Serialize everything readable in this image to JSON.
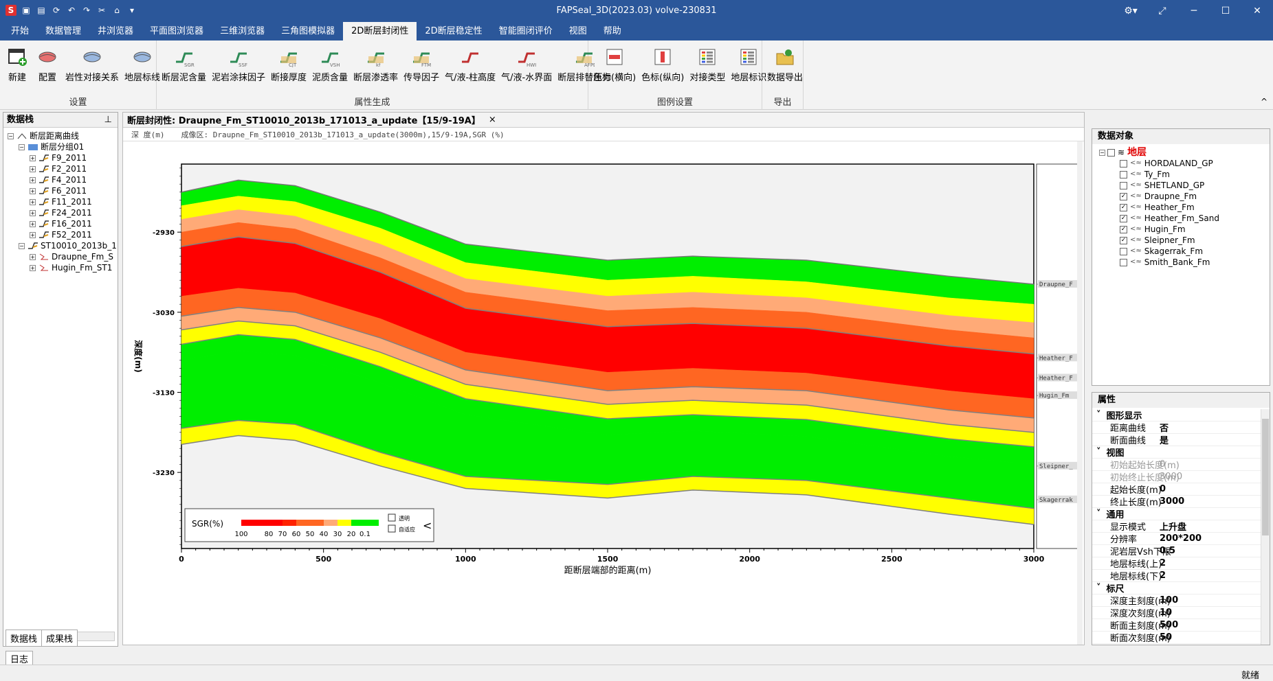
{
  "window": {
    "title": "FAPSeal_3D(2023.03) volve-230831"
  },
  "menu": [
    "开始",
    "数据管理",
    "井浏览器",
    "平面图浏览器",
    "三维浏览器",
    "三角图模拟器",
    "2D断层封闭性",
    "2D断层稳定性",
    "智能圈闭评价",
    "视图",
    "帮助"
  ],
  "menu_active": 6,
  "ribbon": {
    "groups": [
      {
        "label": "设置",
        "buttons": [
          "新建",
          "配置",
          "岩性对接关系",
          "地层标线"
        ]
      },
      {
        "label": "属性生成",
        "buttons": [
          "断层泥含量",
          "泥岩涂抹因子",
          "断接厚度",
          "泥质含量",
          "断层渗透率",
          "传导因子",
          "气/液-柱高度",
          "气/液-水界面",
          "断层排替压力"
        ]
      },
      {
        "label": "图例设置",
        "buttons": [
          "色标(横向)",
          "色标(纵向)",
          "对接类型",
          "地层标识"
        ]
      },
      {
        "label": "导出",
        "buttons": [
          "数据导出"
        ]
      }
    ],
    "icon_tags": {
      "sgr": "SGR",
      "ssf": "SSF",
      "cjt": "CJT",
      "vsh": "VSH",
      "kf": "kf",
      "ftm": "FTM",
      "hwi": "HWI",
      "afpd": "AFPD"
    }
  },
  "left_panel": {
    "title": "数据栈",
    "pin": "中",
    "tree": [
      {
        "label": "断层距离曲线",
        "level": 0
      },
      {
        "label": "断层分组01",
        "level": 1
      },
      {
        "label": "F9_2011",
        "level": 2
      },
      {
        "label": "F2_2011",
        "level": 2
      },
      {
        "label": "F4_2011",
        "level": 2
      },
      {
        "label": "F6_2011",
        "level": 2
      },
      {
        "label": "F11_2011",
        "level": 2
      },
      {
        "label": "F24_2011",
        "level": 2
      },
      {
        "label": "F16_2011",
        "level": 2
      },
      {
        "label": "F52_2011",
        "level": 2
      },
      {
        "label": "ST10010_2013b_1",
        "level": 1
      },
      {
        "label": "Draupne_Fm_S",
        "level": 2
      },
      {
        "label": "Hugin_Fm_ST1",
        "level": 2
      }
    ],
    "tabs": [
      "数据栈",
      "成果栈"
    ]
  },
  "doc": {
    "tab_title": "断层封闭性: Draupne_Fm_ST10010_2013b_171013_a_update【15/9-19A】",
    "close": "×",
    "info_depth": "深 度(m)",
    "info_zone": "成像区: Draupne_Fm_ST10010_2013b_171013_a_update(3000m),15/9-19A,SGR (%)"
  },
  "chart_data": {
    "type": "area",
    "xlabel": "距断层端部的距离(m)",
    "ylabel": "深度(m)",
    "xlim": [
      0,
      3000
    ],
    "ylim": [
      -2845,
      -3325
    ],
    "x_ticks": [
      0,
      500,
      1000,
      1500,
      2000,
      2500,
      3000
    ],
    "y_ticks": [
      -2930,
      -3030,
      -3130,
      -3230
    ],
    "x": [
      0,
      200,
      400,
      700,
      1000,
      1500,
      1800,
      2200,
      2700,
      3000
    ],
    "boundaries": [
      [
        -2880,
        -2865,
        -2872,
        -2905,
        -2945,
        -2965,
        -2960,
        -2965,
        -2985,
        -2995
      ],
      [
        -2897,
        -2885,
        -2892,
        -2925,
        -2968,
        -2990,
        -2985,
        -2992,
        -3012,
        -3020
      ],
      [
        -2914,
        -2902,
        -2910,
        -2945,
        -2988,
        -3010,
        -3005,
        -3012,
        -3034,
        -3043
      ],
      [
        -2930,
        -2918,
        -2926,
        -2962,
        -3005,
        -3028,
        -3024,
        -3030,
        -3052,
        -3062
      ],
      [
        -2948,
        -2936,
        -2944,
        -2980,
        -3025,
        -3048,
        -3044,
        -3050,
        -3072,
        -3082
      ],
      [
        -3010,
        -3000,
        -3006,
        -3038,
        -3080,
        -3105,
        -3100,
        -3106,
        -3128,
        -3138
      ],
      [
        -3035,
        -3024,
        -3030,
        -3062,
        -3102,
        -3128,
        -3123,
        -3128,
        -3152,
        -3162
      ],
      [
        -3052,
        -3041,
        -3047,
        -3080,
        -3120,
        -3145,
        -3140,
        -3146,
        -3170,
        -3180
      ],
      [
        -3070,
        -3058,
        -3064,
        -3098,
        -3138,
        -3163,
        -3158,
        -3164,
        -3188,
        -3198
      ],
      [
        -3090,
        -3078,
        -3084,
        -3118,
        -3158,
        -3183,
        -3178,
        -3185,
        -3210,
        -3220
      ],
      [
        -3175,
        -3165,
        -3170,
        -3205,
        -3235,
        -3245,
        -3235,
        -3240,
        -3262,
        -3275
      ],
      [
        -3195,
        -3184,
        -3190,
        -3222,
        -3250,
        -3262,
        -3252,
        -3258,
        -3282,
        -3295
      ]
    ],
    "band_colors": [
      "#00ee00",
      "#ffff00",
      "#ffaa77",
      "#ff6622",
      "#ff0000",
      "#ff6622",
      "#ffaa77",
      "#ffff00",
      "#00ee00",
      "#00ee00",
      "#ffff00"
    ],
    "horizon_lines": [
      {
        "name": "Draupne_Fm",
        "values": [
          -2948,
          -2936,
          -2944,
          -2980,
          -3025,
          -3048,
          -3044,
          -3050,
          -3072,
          -3082
        ]
      },
      {
        "name": "Heather_Fm",
        "values": [
          -3035,
          -3024,
          -3030,
          -3062,
          -3102,
          -3128,
          -3123,
          -3128,
          -3152,
          -3162
        ]
      },
      {
        "name": "Heather_Fm_Sand",
        "values": [
          -3052,
          -3041,
          -3047,
          -3080,
          -3120,
          -3145,
          -3140,
          -3146,
          -3170,
          -3180
        ]
      },
      {
        "name": "Hugin_Fm",
        "values": [
          -3070,
          -3058,
          -3064,
          -3098,
          -3138,
          -3163,
          -3158,
          -3164,
          -3188,
          -3198
        ]
      },
      {
        "name": "Sleipner_Fm",
        "values": [
          -3175,
          -3165,
          -3170,
          -3205,
          -3235,
          -3245,
          -3235,
          -3240,
          -3262,
          -3275
        ]
      },
      {
        "name": "Skagerrak_Fm",
        "values": [
          -3195,
          -3184,
          -3190,
          -3222,
          -3250,
          -3262,
          -3252,
          -3258,
          -3282,
          -3295
        ]
      }
    ],
    "side_labels": [
      {
        "text": "Draupne_F",
        "depth": -2995
      },
      {
        "text": "Heather_F",
        "depth": -3087
      },
      {
        "text": "Heather_F",
        "depth": -3112
      },
      {
        "text": "Hugin_Fm",
        "depth": -3134
      },
      {
        "text": "Sleipner_",
        "depth": -3222
      },
      {
        "text": "Skagerrak",
        "depth": -3264
      }
    ],
    "legend": {
      "title": "SGR(%)",
      "ticks": [
        "100",
        "80",
        "70",
        "60",
        "50",
        "40",
        "30",
        "20",
        "0.1"
      ],
      "colors": [
        "#ff0000",
        "#ff0000",
        "#ff0000",
        "#ff2200",
        "#ff6622",
        "#ff6622",
        "#ffaa77",
        "#ffff00",
        "#00ee00",
        "#00ee00"
      ],
      "options": [
        "透明",
        "自适应"
      ],
      "toggle": "<"
    }
  },
  "data_objects": {
    "title": "数据对象",
    "root": "地层",
    "items": [
      {
        "label": "HORDALAND_GP",
        "checked": false
      },
      {
        "label": "Ty_Fm",
        "checked": false
      },
      {
        "label": "SHETLAND_GP",
        "checked": false
      },
      {
        "label": "Draupne_Fm",
        "checked": true
      },
      {
        "label": "Heather_Fm",
        "checked": true
      },
      {
        "label": "Heather_Fm_Sand",
        "checked": true
      },
      {
        "label": "Hugin_Fm",
        "checked": true
      },
      {
        "label": "Sleipner_Fm",
        "checked": true
      },
      {
        "label": "Skagerrak_Fm",
        "checked": false
      },
      {
        "label": "Smith_Bank_Fm",
        "checked": false
      }
    ]
  },
  "properties": {
    "title": "属性",
    "rows": [
      {
        "section": "图形显示"
      },
      {
        "k": "距离曲线",
        "v": "否"
      },
      {
        "k": "断面曲线",
        "v": "是"
      },
      {
        "section": "视图"
      },
      {
        "k": "初始起始长度(m)",
        "v": "0",
        "dis": true
      },
      {
        "k": "初始终止长度(m)",
        "v": "3000",
        "dis": true
      },
      {
        "k": "起始长度(m)",
        "v": "0"
      },
      {
        "k": "终止长度(m)",
        "v": "3000"
      },
      {
        "section": "通用"
      },
      {
        "k": "显示模式",
        "v": "上升盘"
      },
      {
        "k": "分辨率",
        "v": "200*200"
      },
      {
        "k": "泥岩层Vsh下限",
        "v": "0.5"
      },
      {
        "k": "地层标线(上)",
        "v": "2"
      },
      {
        "k": "地层标线(下)",
        "v": "2"
      },
      {
        "section": "标尺"
      },
      {
        "k": "深度主刻度(m)",
        "v": "100"
      },
      {
        "k": "深度次刻度(m)",
        "v": "10"
      },
      {
        "k": "断面主刻度(m)",
        "v": "500"
      },
      {
        "k": "断面次刻度(m)",
        "v": "50"
      }
    ]
  },
  "log_tab": "日志",
  "status": "就绪"
}
